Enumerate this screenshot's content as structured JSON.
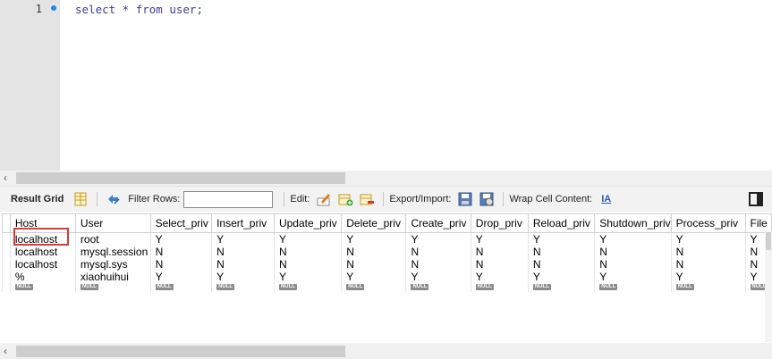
{
  "editor": {
    "line_number": "1",
    "code": "select * from user;"
  },
  "toolbar": {
    "result_grid_label": "Result Grid",
    "filter_rows_label": "Filter Rows:",
    "filter_rows_value": "",
    "edit_label": "Edit:",
    "export_import_label": "Export/Import:",
    "wrap_cell_label": "Wrap Cell Content:",
    "wrap_cell_icon_text": "IA"
  },
  "grid": {
    "columns": [
      "Host",
      "User",
      "Select_priv",
      "Insert_priv",
      "Update_priv",
      "Delete_priv",
      "Create_priv",
      "Drop_priv",
      "Reload_priv",
      "Shutdown_priv",
      "Process_priv",
      "File"
    ],
    "rows": [
      [
        "localhost",
        "root",
        "Y",
        "Y",
        "Y",
        "Y",
        "Y",
        "Y",
        "Y",
        "Y",
        "Y",
        "Y"
      ],
      [
        "localhost",
        "mysql.session",
        "N",
        "N",
        "N",
        "N",
        "N",
        "N",
        "N",
        "N",
        "N",
        "N"
      ],
      [
        "localhost",
        "mysql.sys",
        "N",
        "N",
        "N",
        "N",
        "N",
        "N",
        "N",
        "N",
        "N",
        "N"
      ],
      [
        "%",
        "xiaohuihui",
        "Y",
        "Y",
        "Y",
        "Y",
        "Y",
        "Y",
        "Y",
        "Y",
        "Y",
        "Y"
      ]
    ],
    "null_label": "NULL"
  },
  "colors": {
    "highlight_border": "#d93a3a",
    "keyword": "#3b3b9c",
    "exec_dot": "#1e88e5"
  }
}
